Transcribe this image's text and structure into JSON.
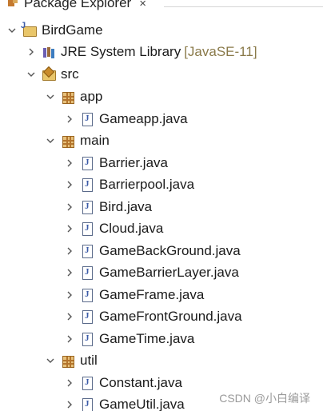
{
  "tab": {
    "title": "Package Explorer",
    "close": "×"
  },
  "tree": {
    "project": {
      "label": "BirdGame"
    },
    "jre": {
      "label": "JRE System Library",
      "suffix": "[JavaSE-11]"
    },
    "src": {
      "label": "src"
    },
    "pkg_app": {
      "label": "app"
    },
    "app_files": [
      "Gameapp.java"
    ],
    "pkg_main": {
      "label": "main"
    },
    "main_files": [
      "Barrier.java",
      "Barrierpool.java",
      "Bird.java",
      "Cloud.java",
      "GameBackGround.java",
      "GameBarrierLayer.java",
      "GameFrame.java",
      "GameFrontGround.java",
      "GameTime.java"
    ],
    "pkg_util": {
      "label": "util"
    },
    "util_files": [
      "Constant.java",
      "GameUtil.java"
    ]
  },
  "watermark": "CSDN @小白编译",
  "icons": {
    "expanded": "chevron-down-icon",
    "collapsed": "chevron-right-icon",
    "project": "java-project-icon",
    "library": "library-icon",
    "source_folder": "source-folder-icon",
    "package": "package-icon",
    "java_file": "java-file-icon"
  }
}
